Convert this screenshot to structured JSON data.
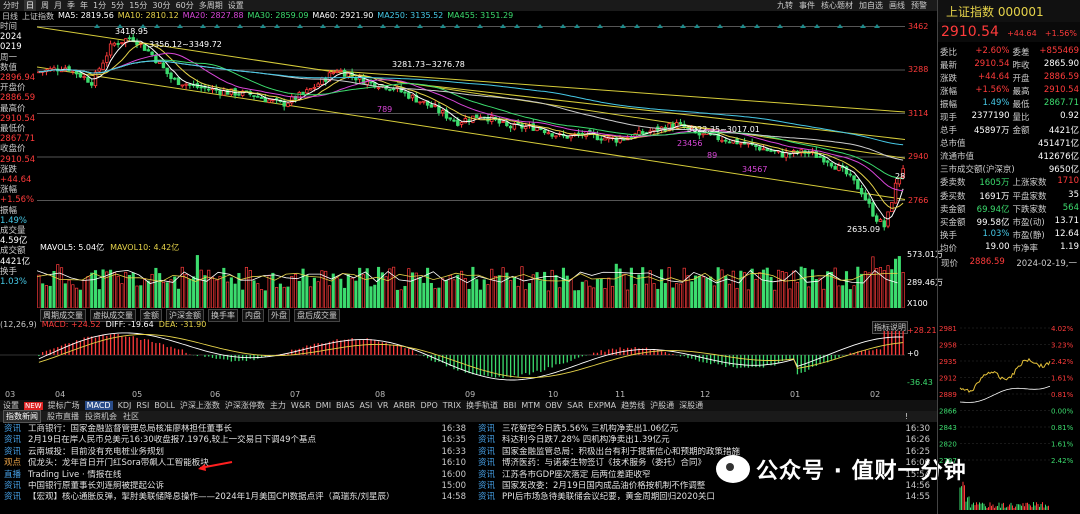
{
  "toolbar": {
    "left_items": [
      "分时",
      "日",
      "周",
      "月",
      "季",
      "年",
      "1分",
      "5分",
      "15分",
      "30分",
      "60分",
      "多周期",
      "设置"
    ],
    "selected": "日",
    "right_items": [
      "九转",
      "事件",
      "核心题材",
      "加自选",
      "画线",
      "预警"
    ]
  },
  "ma_bar": {
    "name": "日线",
    "index_name": "上证指数",
    "ma5": "MA5: 2819.56",
    "ma10": "MA10: 2810.12",
    "ma20": "MA20: 2827.88",
    "ma30": "MA30: 2859.09",
    "ma60": "MA60: 2921.90",
    "ma250": "MA250: 3135.52",
    "ma455": "MA455: 3151.29"
  },
  "left_panel": {
    "time_label": "时间",
    "year": "2024",
    "date": "0219",
    "weekday_label": "周一",
    "count_label": "数值",
    "count_value": "2896.94",
    "open_label": "开盘价",
    "open_value": "2886.59",
    "high_label": "最高价",
    "high_value": "2910.54",
    "low_label": "最低价",
    "low_value": "2867.71",
    "close_label": "收盘价",
    "close_value": "2910.54",
    "chg_label": "涨跌",
    "chg_value": "+44.64",
    "pct_label": "涨幅",
    "pct_value": "+1.56%",
    "amp_label": "振幅",
    "amp_value": "1.49%",
    "vol_label": "成交量",
    "vol_value": "4.59亿",
    "amt_label": "成交额",
    "amt_value": "4421亿",
    "turn_label": "换手",
    "turn_value": "1.03%"
  },
  "price_axis": [
    "3462",
    "3288",
    "3114",
    "2940",
    "2766"
  ],
  "chart_annotations": {
    "high_label": "3418.95",
    "range1": "3356.12~3349.72",
    "range2": "3281.73~3276.78",
    "range3": "3022.35~3017.01",
    "low_label": "2635.09",
    "num_28": "28",
    "num_789": "789",
    "num_23456": "23456",
    "num_89": "89",
    "num_34567": "34567"
  },
  "volume": {
    "mavol5": "MAVOL5: 5.04亿",
    "mavol10": "MAVOL10: 4.42亿",
    "axis_top": "573.01万",
    "axis_mid": "289.46万",
    "axis_unit": "X100",
    "tabs": [
      "周期成交量",
      "虚拟成交量",
      "金额",
      "沪深金额",
      "换手率",
      "内盘",
      "外盘",
      "盘后成交量"
    ]
  },
  "macd": {
    "params": "(12,26,9)",
    "macd_value": "MACD: +24.52",
    "diff_value": "DIFF: -19.64",
    "dea_value": "DEA: -31.90",
    "button": "指标说明",
    "axis_top": "+28.21",
    "axis_mid": "+0",
    "axis_bot": "-36.43"
  },
  "x_months": [
    "03",
    "04",
    "05",
    "06",
    "07",
    "08",
    "09",
    "10",
    "11",
    "12",
    "01",
    "02"
  ],
  "indicator_tabs": [
    "设置",
    "NEW",
    "提标广场",
    "MACD",
    "KDJ",
    "RSI",
    "BOLL",
    "沪深上涨数",
    "沪深涨停数",
    "主力",
    "W&R",
    "DMI",
    "BIAS",
    "ASI",
    "VR",
    "ARBR",
    "DPO",
    "TRIX",
    "换手轨道",
    "BBI",
    "MTM",
    "OBV",
    "SAR",
    "EXPMA",
    "趋势线",
    "沪股通",
    "深股通"
  ],
  "news_tabs": [
    "指数新闻",
    "股市直播",
    "投资机会",
    "社区"
  ],
  "news_left": [
    {
      "tag": "资讯",
      "title": "工商银行：国家金融监督管理总局核准廖林担任董事长",
      "time": "16:38"
    },
    {
      "tag": "资讯",
      "title": "2月19日在岸人民币兑美元16:30收盘报7.1976,较上一交易日下调49个基点",
      "time": "16:35"
    },
    {
      "tag": "资讯",
      "title": "云南城投：目前没有充电桩业务规划",
      "time": "16:33"
    },
    {
      "tag": "观点",
      "title": "侃龙头：龙年首日开门红Sora带飙人工智能板块",
      "time": "16:10"
    },
    {
      "tag": "直播",
      "title": "Trading Live · 情报在线",
      "time": "16:00"
    },
    {
      "tag": "资讯",
      "title": "中国银行原董事长刘连舸被提起公诉",
      "time": "15:00"
    },
    {
      "tag": "资讯",
      "title": "【宏观】核心通胀反弹，掣肘美联储降息操作——2024年1月美国CPI数据点评（高瑞东/刘星辰）",
      "time": "14:58"
    }
  ],
  "news_right": [
    {
      "tag": "资讯",
      "title": "三花智控今日跌5.56% 三机构净卖出1.06亿元",
      "time": "16:30"
    },
    {
      "tag": "资讯",
      "title": "科达利今日跌7.28% 四机构净卖出1.39亿元",
      "time": "16:26"
    },
    {
      "tag": "资讯",
      "title": "国家金融监管总局：积极出台有利于提振信心和预期的政策措施",
      "time": "16:25"
    },
    {
      "tag": "资讯",
      "title": "博济医药：与诺泰生物签订《技术服务（委托）合同》",
      "time": "16:06"
    },
    {
      "tag": "资讯",
      "title": "江苏各市GDP座次落定 后两位差距收窄",
      "time": "15:54"
    },
    {
      "tag": "资讯",
      "title": "国家发改委：2月19日国内成品油价格按机制不作调整",
      "time": "14:56"
    },
    {
      "tag": "资讯",
      "title": "PPI后市场急待美联储会议纪要，黄金周期回归2020关口",
      "time": "14:55"
    }
  ],
  "watermark_text": "公众号 · 值财一分钟",
  "right_panel": {
    "title": "上证指数 000001",
    "price": "2910.54",
    "chg": "+44.64",
    "pct": "+1.56%",
    "rows": [
      {
        "l": "委比",
        "lv": "+2.60%",
        "r": "委差",
        "rv": "+855469"
      },
      {
        "l": "最新",
        "lv": "2910.54",
        "r": "昨收",
        "rv": "2865.90"
      },
      {
        "l": "涨跌",
        "lv": "+44.64",
        "r": "开盘",
        "rv": "2886.59"
      },
      {
        "l": "涨幅",
        "lv": "+1.56%",
        "r": "最高",
        "rv": "2910.54"
      },
      {
        "l": "振幅",
        "lv": "1.49%",
        "r": "最低",
        "rv": "2867.71"
      },
      {
        "l": "现手",
        "lv": "2377190",
        "r": "量比",
        "rv": "0.92"
      },
      {
        "l": "总手",
        "lv": "45897万",
        "r": "金额",
        "rv": "4421亿"
      },
      {
        "l": "总市值",
        "lv": "",
        "r": "",
        "rv": "451471亿"
      },
      {
        "l": "流通市值",
        "lv": "",
        "r": "",
        "rv": "412676亿"
      },
      {
        "l": "三市成交额(沪深京)",
        "lv": "",
        "r": "",
        "rv": "9650亿"
      },
      {
        "l": "委卖数",
        "lv": "1605万",
        "r": "上涨家数",
        "rv": "1710"
      },
      {
        "l": "委买数",
        "lv": "1691万",
        "r": "平盘家数",
        "rv": "35"
      },
      {
        "l": "卖金额",
        "lv": "69.94亿",
        "r": "下跌家数",
        "rv": "564"
      },
      {
        "l": "买金额",
        "lv": "99.58亿",
        "r": "市盈(动)",
        "rv": "13.71"
      },
      {
        "l": "换手",
        "lv": "1.03%",
        "r": "市盈(静)",
        "rv": "12.64"
      },
      {
        "l": "均价",
        "lv": "19.00",
        "r": "市净率",
        "rv": "1.19"
      }
    ],
    "intraday_label": "现价",
    "intraday_price": "2886.59",
    "intraday_date": "2024-02-19,一",
    "intraday_left_axis": [
      "2981",
      "2958",
      "2935",
      "2912",
      "2889",
      "2866",
      "2843",
      "2820",
      "2797"
    ],
    "intraday_right_axis": [
      "4.02%",
      "3.23%",
      "2.42%",
      "1.61%",
      "0.81%",
      "0.00%",
      "0.81%",
      "1.61%",
      "2.42%"
    ]
  },
  "colors": {
    "up": "#ff3b3b",
    "down": "#3cdc6e",
    "accent": "#e6d34a",
    "cyan": "#46c8e6"
  }
}
